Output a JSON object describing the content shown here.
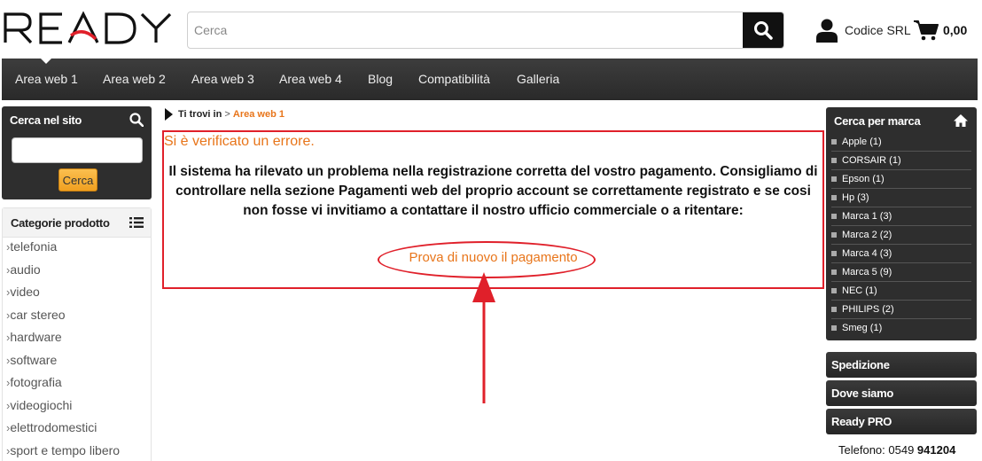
{
  "header": {
    "logo_text": "READY",
    "search_placeholder": "Cerca",
    "company_name": "Codice SRL",
    "cart_total": "0,00"
  },
  "nav": {
    "items": [
      {
        "label": "Area web 1"
      },
      {
        "label": "Area web 2"
      },
      {
        "label": "Area web 3"
      },
      {
        "label": "Area web 4"
      },
      {
        "label": "Blog"
      },
      {
        "label": "Compatibilità"
      },
      {
        "label": "Galleria"
      }
    ]
  },
  "site_search": {
    "title": "Cerca nel sito",
    "button_label": "Cerca"
  },
  "categories": {
    "title": "Categorie prodotto",
    "items": [
      {
        "label": "telefonia"
      },
      {
        "label": "audio"
      },
      {
        "label": "video"
      },
      {
        "label": "car stereo"
      },
      {
        "label": "hardware"
      },
      {
        "label": "software"
      },
      {
        "label": "fotografia"
      },
      {
        "label": "videogiochi"
      },
      {
        "label": "elettrodomestici"
      },
      {
        "label": "sport e tempo libero"
      }
    ]
  },
  "breadcrumb": {
    "label": "Ti trovi in",
    "separator": ">",
    "current": "Area web 1"
  },
  "error": {
    "title": "Si è verificato un errore.",
    "message": "Il sistema ha rilevato un problema nella registrazione corretta del vostro pagamento. Consigliamo di controllare nella sezione Pagamenti web del proprio account se correttamente registrato e se cosi non fosse vi invitiamo a contattare il nostro ufficio commerciale o a ritentare:",
    "retry_link": "Prova di nuovo il pagamento"
  },
  "brands": {
    "title": "Cerca per marca",
    "items": [
      {
        "label": "Apple (1)"
      },
      {
        "label": "CORSAIR (1)"
      },
      {
        "label": "Epson (1)"
      },
      {
        "label": "Hp (3)"
      },
      {
        "label": "Marca 1 (3)"
      },
      {
        "label": "Marca 2 (2)"
      },
      {
        "label": "Marca 4 (3)"
      },
      {
        "label": "Marca 5 (9)"
      },
      {
        "label": "NEC (1)"
      },
      {
        "label": "PHILIPS (2)"
      },
      {
        "label": "Smeg (1)"
      }
    ]
  },
  "side_links": {
    "shipping": "Spedizione",
    "location": "Dove siamo",
    "pro": "Ready PRO"
  },
  "contact": {
    "phone_label": "Telefono: 0549",
    "phone_number": "941204"
  },
  "colors": {
    "accent_orange": "#e8751a",
    "annotation_red": "#e0202a",
    "dark_panel": "#2e2e2e"
  }
}
